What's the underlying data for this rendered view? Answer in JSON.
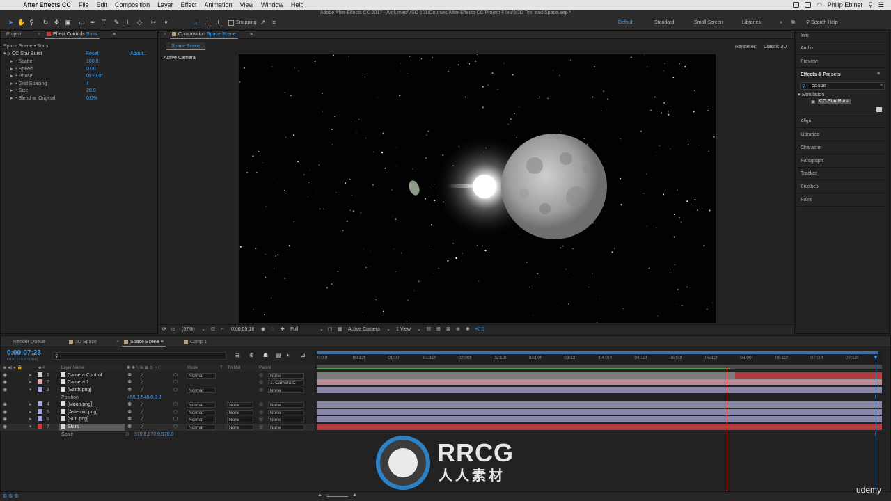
{
  "menubar": {
    "app": "After Effects CC",
    "items": [
      "File",
      "Edit",
      "Composition",
      "Layer",
      "Effect",
      "Animation",
      "View",
      "Window",
      "Help"
    ],
    "user": "Philip Ebiner"
  },
  "titlebar": {
    "text": "Adobe After Effects CC 2017 - /Volumes/VSO 101/Courses/After Effects CC/Project Files/3/3D Text and Space.aep *"
  },
  "toolbar": {
    "snapping": "Snapping",
    "workspaces": [
      "Default",
      "Standard",
      "Small Screen",
      "Libraries"
    ],
    "search_placeholder": "Search Help"
  },
  "left_panel": {
    "tab_project": "Project",
    "tab_effect": "Effect Controls",
    "tab_effect_target": "Stars",
    "breadcrumb": "Space Scene • Stars",
    "effect_name": "CC Star Burst",
    "reset": "Reset",
    "about": "About...",
    "params": [
      {
        "name": "Scatter",
        "value": "100.0"
      },
      {
        "name": "Speed",
        "value": "0.00"
      },
      {
        "name": "Phase",
        "value": "0x+0.0°"
      },
      {
        "name": "Grid Spacing",
        "value": "4"
      },
      {
        "name": "Size",
        "value": "20.0"
      },
      {
        "name": "Blend w. Original",
        "value": "0.0%"
      }
    ]
  },
  "composition": {
    "tab_label": "Composition",
    "tab_target": "Space Scene",
    "subtab": "Space Scene",
    "renderer_label": "Renderer:",
    "renderer": "Classic 3D",
    "camera_label": "Active Camera",
    "footer": {
      "zoom": "(57%)",
      "timecode": "0:00:05:18",
      "quality": "Full",
      "camera": "Active Camera",
      "views": "1 View",
      "exposure": "+0.0"
    }
  },
  "right_panel": {
    "items_top": [
      "Info",
      "Audio",
      "Preview"
    ],
    "effects_title": "Effects & Presets",
    "search_value": "cc star",
    "category": "Simulation",
    "result": "CC Star Burst",
    "items_bottom": [
      "Align",
      "Libraries",
      "Character",
      "Paragraph",
      "Tracker",
      "Brushes",
      "Paint"
    ]
  },
  "timeline": {
    "tabs": [
      "Render Queue",
      "3D Space",
      "Space Scene",
      "Comp 1"
    ],
    "timecode": "0:00:07:23",
    "fps": "00191 (23.976 fps)",
    "headers": {
      "layer_name": "Layer Name",
      "mode": "Mode",
      "t": "T",
      "trkmat": "TrkMat",
      "parent": "Parent"
    },
    "ruler": [
      "0:00f",
      "00:12f",
      "01:00f",
      "01:12f",
      "02:00f",
      "02:12f",
      "03:00f",
      "03:12f",
      "04:00f",
      "04:12f",
      "05:00f",
      "05:12f",
      "06:00f",
      "06:12f",
      "07:00f",
      "07:12f"
    ],
    "layers": [
      {
        "num": "1",
        "name": "Camera Control",
        "mode": "Normal",
        "trkmat": "",
        "parent": "None",
        "label": "#c9c9c9"
      },
      {
        "num": "2",
        "name": "Camera 1",
        "mode": "",
        "trkmat": "",
        "parent": "1. Camera C",
        "label": "#e5a8b3"
      },
      {
        "num": "3",
        "name": "[Earth.png]",
        "mode": "Normal",
        "trkmat": "",
        "parent": "None",
        "label": "#a7a7d8"
      },
      {
        "num": "4",
        "name": "[Moon.png]",
        "mode": "Normal",
        "trkmat": "None",
        "parent": "None",
        "label": "#a7a7d8"
      },
      {
        "num": "5",
        "name": "[Asteroid.png]",
        "mode": "Normal",
        "trkmat": "None",
        "parent": "None",
        "label": "#a7a7d8"
      },
      {
        "num": "6",
        "name": "[Sun.png]",
        "mode": "Normal",
        "trkmat": "None",
        "parent": "None",
        "label": "#a7a7d8"
      },
      {
        "num": "7",
        "name": "Stars",
        "mode": "Normal",
        "trkmat": "None",
        "parent": "None",
        "label": "#d03a3a"
      }
    ],
    "position_label": "Position",
    "position_value": "455.1,540.0,0.0",
    "scale_label": "Scale",
    "scale_value": "970.0,970.0,970.0"
  },
  "watermark": {
    "brand": "RRCG",
    "sub": "人人素材",
    "udemy": "udemy"
  },
  "colors": {
    "accent": "#3f9ff5",
    "stars_bar": "#b33a3f",
    "purple_bar": "#8a88a8",
    "camera_bar": "#b78a95",
    "playhead": "#d02a2a"
  }
}
